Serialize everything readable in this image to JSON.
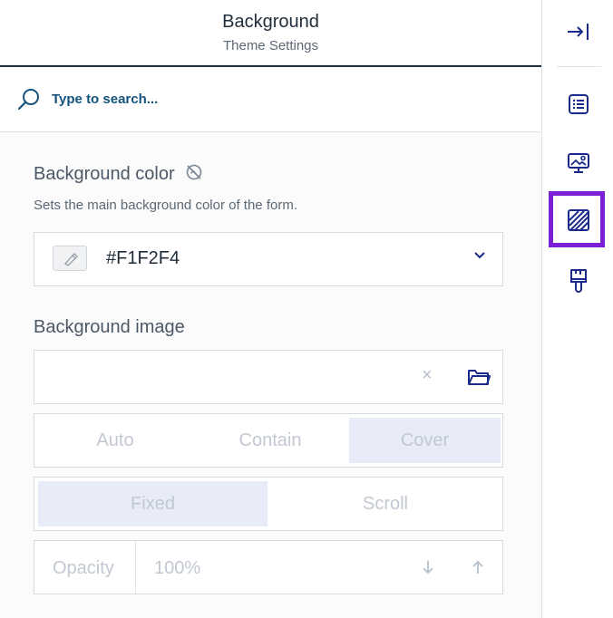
{
  "header": {
    "title": "Background",
    "subtitle": "Theme Settings"
  },
  "search": {
    "placeholder": "Type to search..."
  },
  "background_color": {
    "label": "Background color",
    "description": "Sets the main background color of the form.",
    "value": "#F1F2F4",
    "swatch_color": "#f1f2f4"
  },
  "background_image": {
    "label": "Background image",
    "clear_label": "×",
    "size_options": [
      "Auto",
      "Contain",
      "Cover"
    ],
    "selected_size": "Cover",
    "attachment_options": [
      "Fixed",
      "Scroll"
    ],
    "selected_attachment": "Fixed",
    "opacity_label": "Opacity",
    "opacity_value": "100%"
  },
  "sidebar": {
    "icons": [
      "collapse-panel-icon",
      "general-settings-icon",
      "header-image-icon",
      "background-icon",
      "theme-brush-icon"
    ],
    "active": "background-icon"
  },
  "colors": {
    "accent": "#13537e",
    "active_outline": "#7a1fd6",
    "icon": "#1a2a8a"
  }
}
